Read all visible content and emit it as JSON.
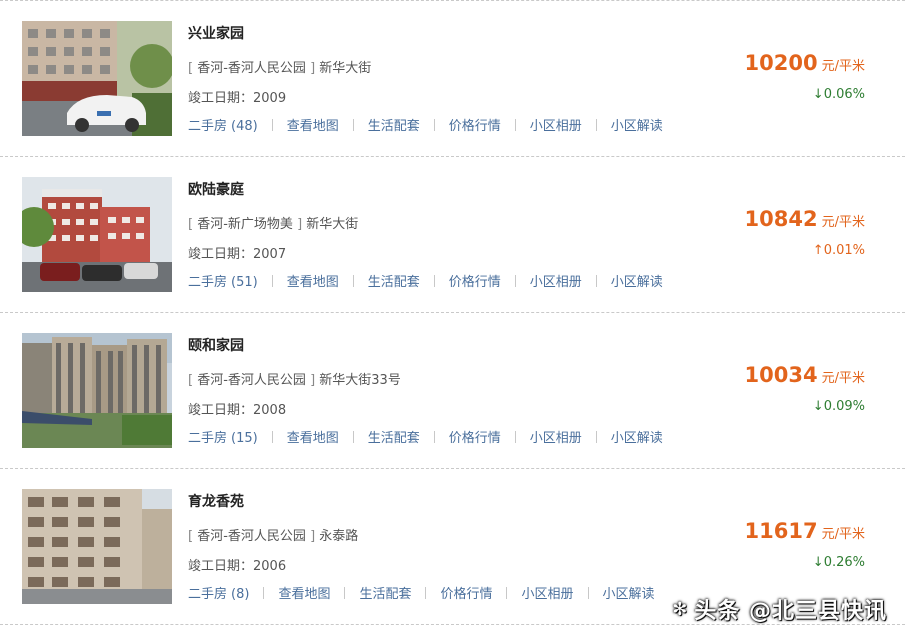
{
  "listings": [
    {
      "name": "兴业家园",
      "district": "香河-香河人民公园",
      "street": "新华大街",
      "built_label": "竣工日期：",
      "built_year": "2009",
      "secondhand_label": "二手房",
      "secondhand_count": "(48)",
      "price": "10200",
      "unit": "元/平米",
      "change": "↓0.06%",
      "trend": "down"
    },
    {
      "name": "欧陆豪庭",
      "district": "香河-新广场物美",
      "street": "新华大街",
      "built_label": "竣工日期：",
      "built_year": "2007",
      "secondhand_label": "二手房",
      "secondhand_count": "(51)",
      "price": "10842",
      "unit": "元/平米",
      "change": "↑0.01%",
      "trend": "up"
    },
    {
      "name": "颐和家园",
      "district": "香河-香河人民公园",
      "street": "新华大街33号",
      "built_label": "竣工日期：",
      "built_year": "2008",
      "secondhand_label": "二手房",
      "secondhand_count": "(15)",
      "price": "10034",
      "unit": "元/平米",
      "change": "↓0.09%",
      "trend": "down"
    },
    {
      "name": "育龙香苑",
      "district": "香河-香河人民公园",
      "street": "永泰路",
      "built_label": "竣工日期：",
      "built_year": "2006",
      "secondhand_label": "二手房",
      "secondhand_count": "(8)",
      "price": "11617",
      "unit": "元/平米",
      "change": "↓0.26%",
      "trend": "down"
    }
  ],
  "actions": {
    "map": "查看地图",
    "amenities": "生活配套",
    "price_trend": "价格行情",
    "album": "小区相册",
    "review": "小区解读"
  },
  "bracket_open": "[",
  "bracket_close": "]",
  "watermark": "头条 @北三县快讯",
  "colors": {
    "price": "#e2641c",
    "down": "#2e7d32",
    "up": "#e2641c",
    "link": "#4a6f9c"
  }
}
